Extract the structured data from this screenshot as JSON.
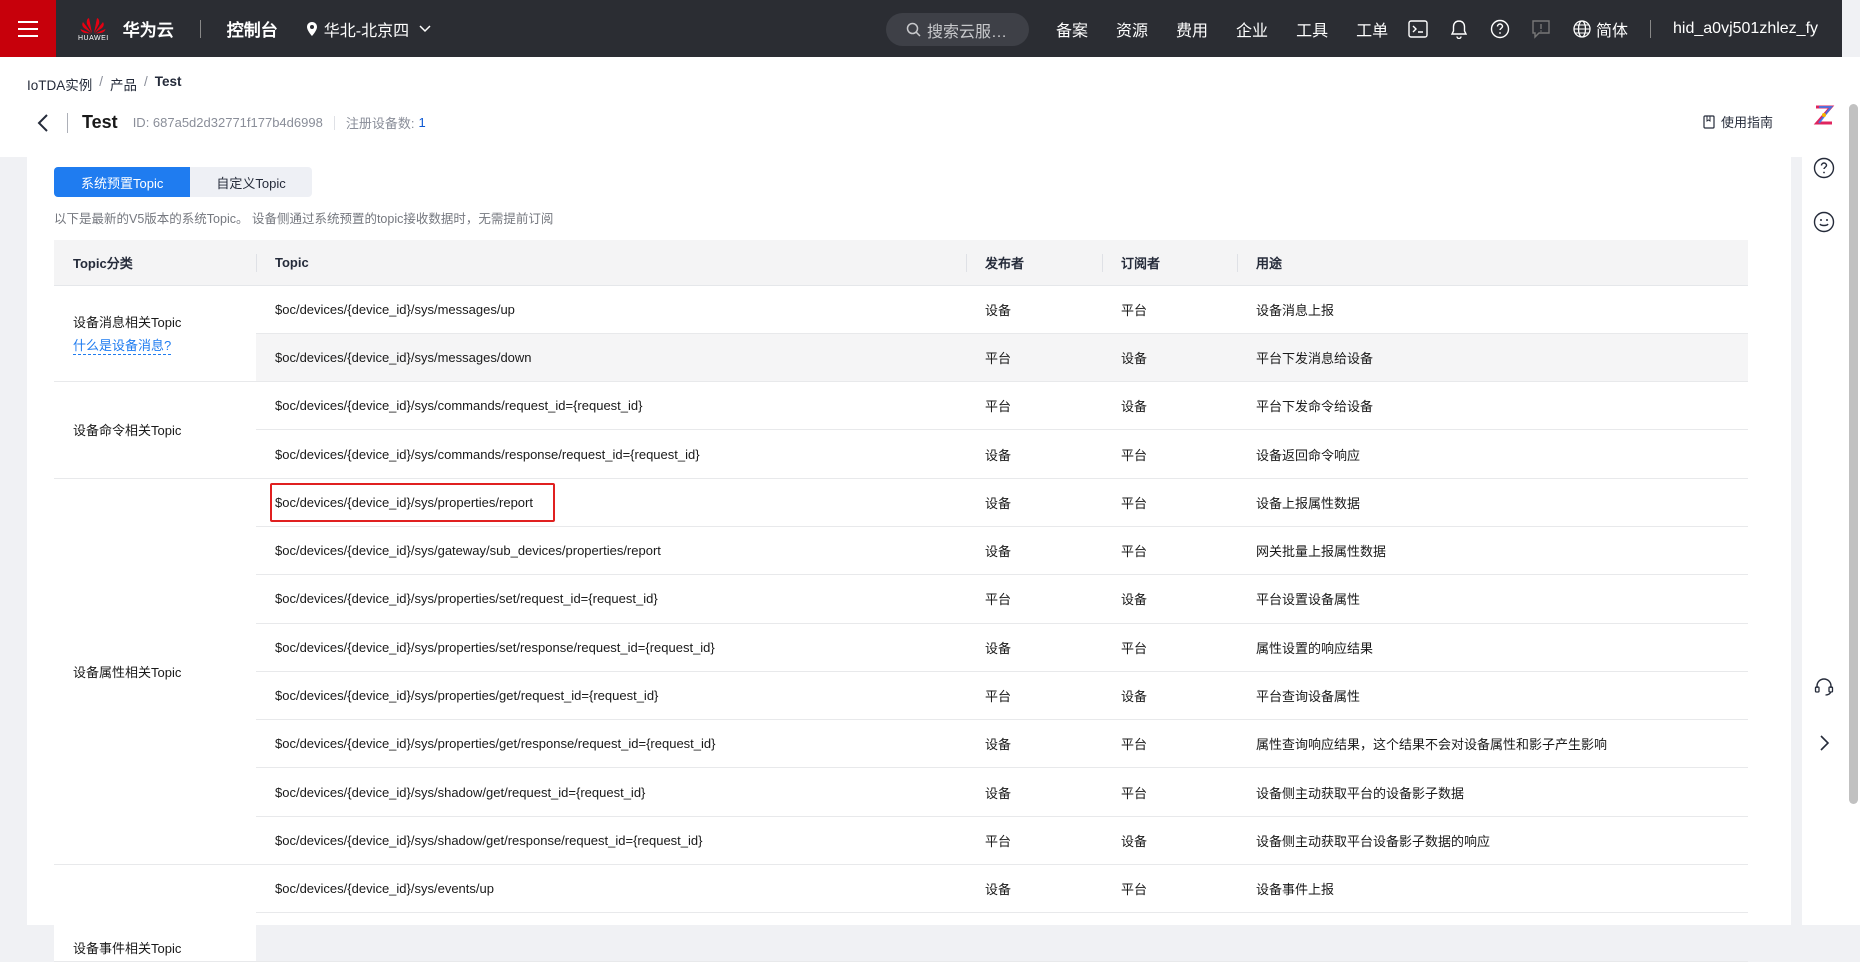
{
  "topbar": {
    "logo_small": "HUAWEI",
    "logo_text": "华为云",
    "console": "控制台",
    "region": "华北-北京四",
    "search_placeholder": "搜索云服…",
    "nav": [
      "备案",
      "资源",
      "费用",
      "企业",
      "工具",
      "工单"
    ],
    "lang": "简体",
    "user": "hid_a0vj501zhlez_fy"
  },
  "breadcrumb": [
    "IoTDA实例",
    "产品",
    "Test"
  ],
  "product": {
    "title": "Test",
    "id_text": "ID: 687a5d2d32771f177b4d6998",
    "registered_label": "注册设备数:",
    "registered_count": "1",
    "guide": "使用指南"
  },
  "tabs": [
    "系统预置Topic",
    "自定义Topic"
  ],
  "description": "以下是最新的V5版本的系统Topic。 设备侧通过系统预置的topic接收数据时，无需提前订阅",
  "table": {
    "headers": [
      "Topic分类",
      "Topic",
      "发布者",
      "订阅者",
      "用途"
    ],
    "groups": [
      {
        "category": "设备消息相关Topic",
        "link": "什么是设备消息?",
        "rows": [
          {
            "topic": "$oc/devices/{device_id}/sys/messages/up",
            "publisher": "设备",
            "subscriber": "平台",
            "usage": "设备消息上报"
          },
          {
            "topic": "$oc/devices/{device_id}/sys/messages/down",
            "publisher": "平台",
            "subscriber": "设备",
            "usage": "平台下发消息给设备"
          }
        ]
      },
      {
        "category": "设备命令相关Topic",
        "rows": [
          {
            "topic": "$oc/devices/{device_id}/sys/commands/request_id={request_id}",
            "publisher": "平台",
            "subscriber": "设备",
            "usage": "平台下发命令给设备"
          },
          {
            "topic": "$oc/devices/{device_id}/sys/commands/response/request_id={request_id}",
            "publisher": "设备",
            "subscriber": "平台",
            "usage": "设备返回命令响应"
          }
        ]
      },
      {
        "category": "设备属性相关Topic",
        "rows": [
          {
            "topic": "$oc/devices/{device_id}/sys/properties/report",
            "publisher": "设备",
            "subscriber": "平台",
            "usage": "设备上报属性数据"
          },
          {
            "topic": "$oc/devices/{device_id}/sys/gateway/sub_devices/properties/report",
            "publisher": "设备",
            "subscriber": "平台",
            "usage": "网关批量上报属性数据"
          },
          {
            "topic": "$oc/devices/{device_id}/sys/properties/set/request_id={request_id}",
            "publisher": "平台",
            "subscriber": "设备",
            "usage": "平台设置设备属性"
          },
          {
            "topic": "$oc/devices/{device_id}/sys/properties/set/response/request_id={request_id}",
            "publisher": "设备",
            "subscriber": "平台",
            "usage": "属性设置的响应结果"
          },
          {
            "topic": "$oc/devices/{device_id}/sys/properties/get/request_id={request_id}",
            "publisher": "平台",
            "subscriber": "设备",
            "usage": "平台查询设备属性"
          },
          {
            "topic": "$oc/devices/{device_id}/sys/properties/get/response/request_id={request_id}",
            "publisher": "设备",
            "subscriber": "平台",
            "usage": "属性查询响应结果，这个结果不会对设备属性和影子产生影响"
          },
          {
            "topic": "$oc/devices/{device_id}/sys/shadow/get/request_id={request_id}",
            "publisher": "设备",
            "subscriber": "平台",
            "usage": "设备侧主动获取平台的设备影子数据"
          },
          {
            "topic": "$oc/devices/{device_id}/sys/shadow/get/response/request_id={request_id}",
            "publisher": "平台",
            "subscriber": "设备",
            "usage": "设备侧主动获取平台设备影子数据的响应"
          }
        ]
      },
      {
        "category": "设备事件相关Topic",
        "rows": [
          {
            "topic": "$oc/devices/{device_id}/sys/events/up",
            "publisher": "设备",
            "subscriber": "平台",
            "usage": "设备事件上报"
          }
        ]
      }
    ]
  },
  "colors": {
    "brand_red": "#c7000b",
    "topbar": "#2b2d33",
    "primary_blue": "#1f7cf0",
    "highlight_red": "#e02020"
  }
}
